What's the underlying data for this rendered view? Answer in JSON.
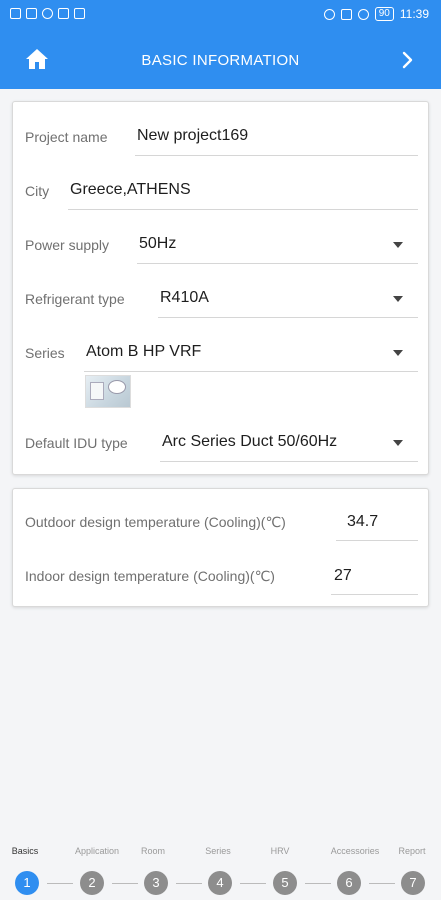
{
  "status_bar": {
    "battery": "90",
    "time": "11:39"
  },
  "header": {
    "title": "BASIC INFORMATION"
  },
  "form": {
    "project_name": {
      "label": "Project name",
      "value": "New project169"
    },
    "city": {
      "label": "City",
      "value": "Greece,ATHENS"
    },
    "power_supply": {
      "label": "Power supply",
      "value": "50Hz"
    },
    "refrigerant": {
      "label": "Refrigerant type",
      "value": "R410A"
    },
    "series": {
      "label": "Series",
      "value": "Atom B HP VRF"
    },
    "idu_type": {
      "label": "Default IDU type",
      "value": "Arc Series Duct 50/60Hz"
    }
  },
  "temperatures": {
    "outdoor": {
      "label": "Outdoor design temperature (Cooling)(℃)",
      "value": "34.7"
    },
    "indoor": {
      "label": "Indoor design temperature (Cooling)(℃)",
      "value": "27"
    }
  },
  "steps": [
    {
      "label": "Basics",
      "num": "1"
    },
    {
      "label": "Application",
      "num": "2"
    },
    {
      "label": "Room",
      "num": "3"
    },
    {
      "label": "Series",
      "num": "4"
    },
    {
      "label": "HRV",
      "num": "5"
    },
    {
      "label": "Accessories",
      "num": "6"
    },
    {
      "label": "Report",
      "num": "7"
    }
  ],
  "colors": {
    "accent": "#2f8ef0",
    "step_inactive": "#8d8d8d"
  }
}
